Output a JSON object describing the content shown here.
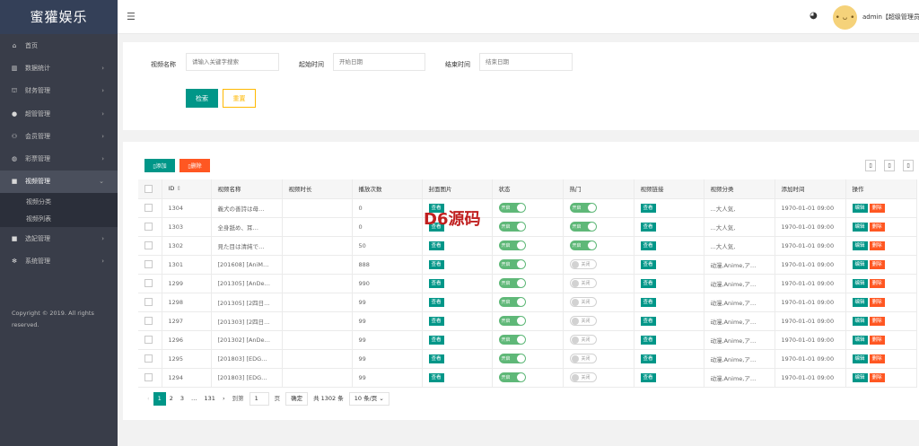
{
  "sidebar": {
    "logo": "蜜獾娱乐",
    "items": [
      {
        "label": "首页",
        "icon": "home-icon",
        "glyph": "⌂",
        "arrow": ""
      },
      {
        "label": "数据统计",
        "icon": "bar-chart-icon",
        "glyph": "▥",
        "arrow": "›"
      },
      {
        "label": "财务管理",
        "icon": "bank-icon",
        "glyph": "⛫",
        "arrow": "›"
      },
      {
        "label": "超管管理",
        "icon": "user-icon",
        "glyph": "●",
        "arrow": "›"
      },
      {
        "label": "会员管理",
        "icon": "users-icon",
        "glyph": "⚇",
        "arrow": "›"
      },
      {
        "label": "彩票管理",
        "icon": "gamepad-icon",
        "glyph": "◍",
        "arrow": "›"
      },
      {
        "label": "视频管理",
        "icon": "video-icon",
        "glyph": "■",
        "arrow": "⌄"
      }
    ],
    "subitems": [
      "视频分类",
      "视频列表"
    ],
    "items2": [
      {
        "label": "选妃管理",
        "icon": "video-icon",
        "glyph": "■",
        "arrow": "›"
      },
      {
        "label": "系统管理",
        "icon": "gear-icon",
        "glyph": "✻",
        "arrow": "›"
      }
    ],
    "copyright": "Copyright © 2019. All rights reserved."
  },
  "topbar": {
    "menu_icon": "☰",
    "theme_icon": "◕",
    "avatar_face": "• ᴗ •",
    "user": "admin【超级管理员】"
  },
  "search": {
    "name_label": "视频名称",
    "name_placeholder": "请输入关键字搜索",
    "start_label": "起始时间",
    "start_placeholder": "开始日期",
    "end_label": "结束时间",
    "end_placeholder": "结束日期",
    "search_btn": "检索",
    "reset_btn": "重置"
  },
  "toolbar": {
    "add": "▯添加",
    "delete": "▯删除",
    "tool_icons": [
      "▯",
      "▯",
      "▯"
    ]
  },
  "table": {
    "headers": [
      "ID",
      "视频名称",
      "视频时长",
      "播放次数",
      "封面图片",
      "状态",
      "热门",
      "视频链接",
      "视频分类",
      "添加时间",
      "操作"
    ],
    "sort_icon": "⇕",
    "view_label": "查看",
    "on_label": "开启",
    "off_label": "关闭",
    "edit_label": "编辑",
    "del_label": "删除",
    "rows": [
      {
        "id": "1304",
        "name": "義犬の善詩は母…",
        "duration": "",
        "plays": "0",
        "hot": true,
        "cat": "...大人気,",
        "time": "1970-01-01 09:00"
      },
      {
        "id": "1303",
        "name": "全身舐め、耳…",
        "duration": "",
        "plays": "0",
        "hot": true,
        "cat": "...大人気,",
        "time": "1970-01-01 09:00"
      },
      {
        "id": "1302",
        "name": "見た目は清純で…",
        "duration": "",
        "plays": "50",
        "hot": true,
        "cat": "...大人気,",
        "time": "1970-01-01 09:00"
      },
      {
        "id": "1301",
        "name": "[201608] [AniM…",
        "duration": "",
        "plays": "888",
        "hot": false,
        "cat": "动漫,Anime,ア…",
        "time": "1970-01-01 09:00"
      },
      {
        "id": "1299",
        "name": "[201305] [AnDe…",
        "duration": "",
        "plays": "990",
        "hot": false,
        "cat": "动漫,Anime,ア…",
        "time": "1970-01-01 09:00"
      },
      {
        "id": "1298",
        "name": "[201305] [2四日…",
        "duration": "",
        "plays": "99",
        "hot": false,
        "cat": "动漫,Anime,ア…",
        "time": "1970-01-01 09:00"
      },
      {
        "id": "1297",
        "name": "[201303] [2四日…",
        "duration": "",
        "plays": "99",
        "hot": false,
        "cat": "动漫,Anime,ア…",
        "time": "1970-01-01 09:00"
      },
      {
        "id": "1296",
        "name": "[201302] [AnDe…",
        "duration": "",
        "plays": "99",
        "hot": false,
        "cat": "动漫,Anime,ア…",
        "time": "1970-01-01 09:00"
      },
      {
        "id": "1295",
        "name": "[201803] [EDG…",
        "duration": "",
        "plays": "99",
        "hot": false,
        "cat": "动漫,Anime,ア…",
        "time": "1970-01-01 09:00"
      },
      {
        "id": "1294",
        "name": "[201803] [EDG…",
        "duration": "",
        "plays": "99",
        "hot": false,
        "cat": "动漫,Anime,ア…",
        "time": "1970-01-01 09:00"
      }
    ]
  },
  "watermark": "D6源码",
  "pager": {
    "prev": "‹",
    "pages": [
      "1",
      "2",
      "3"
    ],
    "ellipsis": "…",
    "last": "131",
    "next": "›",
    "goto": "到第",
    "page_value": "1",
    "page_unit": "页",
    "confirm": "确定",
    "total": "共 1302 条",
    "per_page": "10 条/页 ⌄"
  },
  "colors": {
    "sidebar": "#393d49",
    "primary": "#009688",
    "danger": "#ff5722",
    "switch_on": "#5fb878",
    "reset_border": "#ffb800"
  }
}
